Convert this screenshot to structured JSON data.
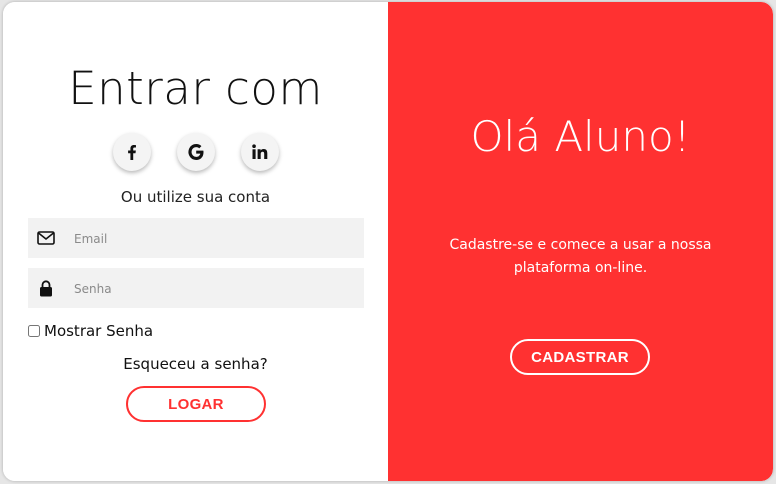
{
  "colors": {
    "accent": "#ff3131",
    "panel_bg": "#ffffff",
    "field_bg": "#f2f2f2"
  },
  "login": {
    "title": "Entrar com",
    "social": [
      {
        "name": "facebook-icon",
        "glyph": "f"
      },
      {
        "name": "google-icon",
        "glyph": "G"
      },
      {
        "name": "linkedin-icon",
        "glyph": "in"
      }
    ],
    "subtitle": "Ou utilize sua conta",
    "email_placeholder": "Email",
    "password_placeholder": "Senha",
    "show_password_label": "Mostrar Senha",
    "forgot_label": "Esqueceu a senha?",
    "login_button": "LOGAR"
  },
  "signup": {
    "title": "Olá Aluno!",
    "text": "Cadastre-se e comece a usar a nossa plataforma on-line.",
    "button": "CADASTRAR"
  }
}
